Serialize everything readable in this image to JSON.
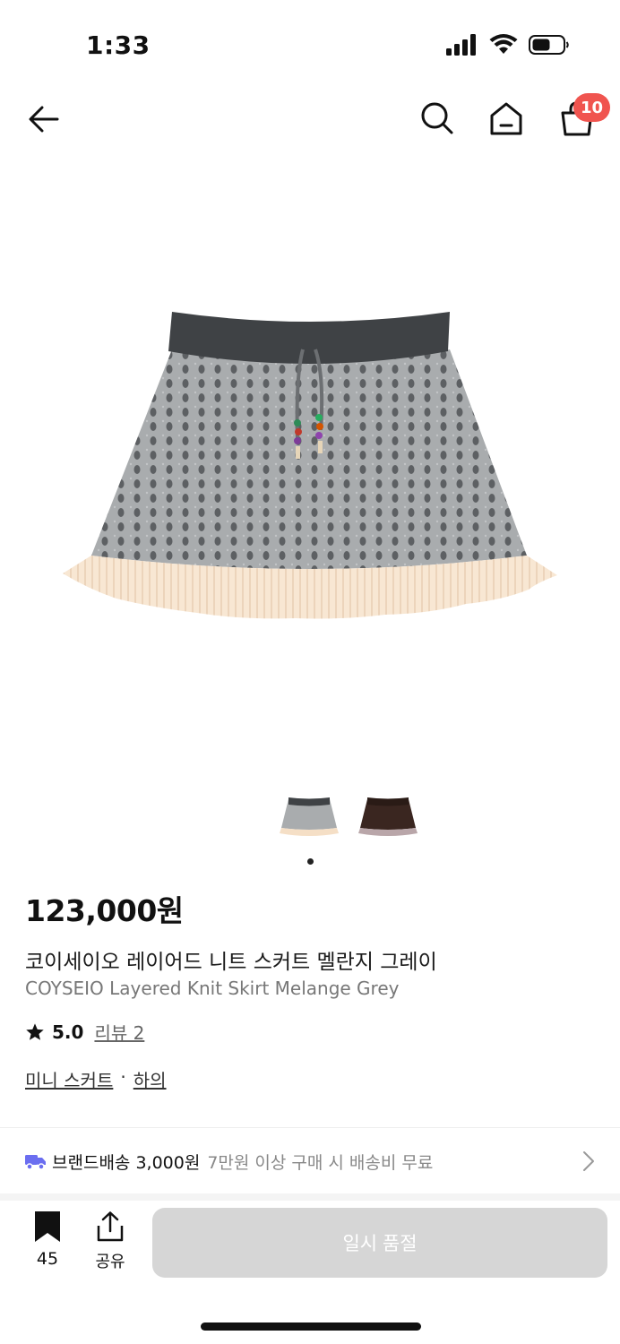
{
  "status": {
    "time": "1:33"
  },
  "nav": {
    "cart_count": "10"
  },
  "gallery": {
    "current_index": 1,
    "total": 1
  },
  "product": {
    "price": "123,000원",
    "name_ko": "코이세이오 레이어드 니트 스커트 멜란지 그레이",
    "name_en": "COYSEIO Layered Knit Skirt Melange Grey",
    "rating": "5.0",
    "review_label": "리뷰 2",
    "category_main": "미니 스커트",
    "category_separator": "·",
    "category_sub": "하의"
  },
  "shipping": {
    "label": "브랜드배송 3,000원",
    "note": "7만원 이상 구매 시 배송비 무료"
  },
  "actions": {
    "bookmark_count": "45",
    "share_label": "공유",
    "soldout_label": "일시 품절"
  },
  "colors": {
    "badge": "#f0544f",
    "truck": "#6b6ef0",
    "button_disabled": "#d6d6d6"
  }
}
